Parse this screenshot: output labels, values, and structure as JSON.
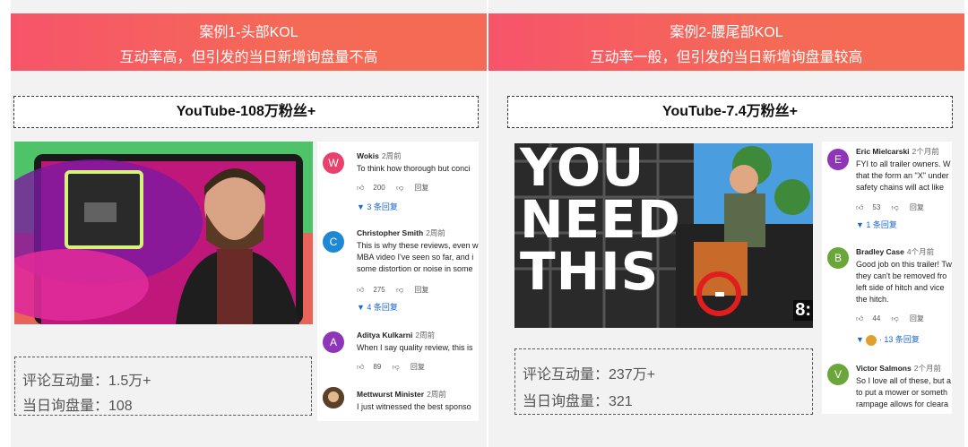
{
  "left": {
    "banner_title": "案例1-头部KOL",
    "banner_subtitle": "互动率高，但引发的当日新增询盘量不高",
    "platform": "YouTube-108万粉丝+",
    "stats": {
      "comments": "评论互动量：1.5万+",
      "inquiries": "当日询盘量：108"
    },
    "comments": [
      {
        "initial": "W",
        "color": "#e8416e",
        "name": "Wokis",
        "ago": "2周前",
        "text": "To think how thorough but conci",
        "likes": "200",
        "reply": "回复",
        "replies": "3 条回复"
      },
      {
        "initial": "C",
        "color": "#1e88d6",
        "name": "Christopher Smith",
        "ago": "2周前",
        "text_lines": [
          "This is why these reviews, even w",
          "MBA video I've seen so far, and i",
          "some distortion or noise in some"
        ],
        "likes": "275",
        "reply": "回复",
        "replies": "4 条回复"
      },
      {
        "initial": "A",
        "color": "#8e35b8",
        "name": "Aditya Kulkarni",
        "ago": "2周前",
        "text": "When I say quality review, this is",
        "likes": "89",
        "reply": "回复"
      },
      {
        "initial": "",
        "color": "#7a5a3a",
        "name": "Mettwurst Minister",
        "ago": "2周前",
        "text": "I just witnessed the best sponso"
      }
    ]
  },
  "right": {
    "banner_title": "案例2-腰尾部KOL",
    "banner_subtitle": "互动率一般，但引发的当日新增询盘量较高",
    "platform": "YouTube-7.4万粉丝+",
    "stats": {
      "comments": "评论互动量：237万+",
      "inquiries": "当日询盘量：321"
    },
    "thumb_text": [
      "YOU",
      "NEED",
      "THIS"
    ],
    "thumb_time": "8:",
    "comments": [
      {
        "initial": "E",
        "color": "#8e35b8",
        "name": "Eric Mielcarski",
        "ago": "2个月前",
        "text_lines": [
          "FYI to all trailer owners. W",
          "that the form an \"X\" under",
          "safety chains will act like"
        ],
        "likes": "53",
        "reply": "回复",
        "replies": "1 条回复"
      },
      {
        "initial": "B",
        "color": "#6aa63a",
        "name": "Bradley Case",
        "ago": "4个月前",
        "text_lines": [
          "Good job on this trailer! Tw",
          "they can't be removed fro",
          "left side of hitch and vice",
          "the hitch."
        ],
        "likes": "44",
        "reply": "回复",
        "replies": "13 条回复"
      },
      {
        "initial": "V",
        "color": "#6aa63a",
        "name": "Victor Salmons",
        "ago": "2个月前",
        "text_lines": [
          "So I love all of these, but a",
          "to put a mower or someth",
          "rampage allows for cleara"
        ]
      }
    ]
  },
  "icons": {
    "like": "thumbs-up-icon",
    "dislike": "thumbs-down-icon",
    "expand": "caret-down-icon"
  }
}
